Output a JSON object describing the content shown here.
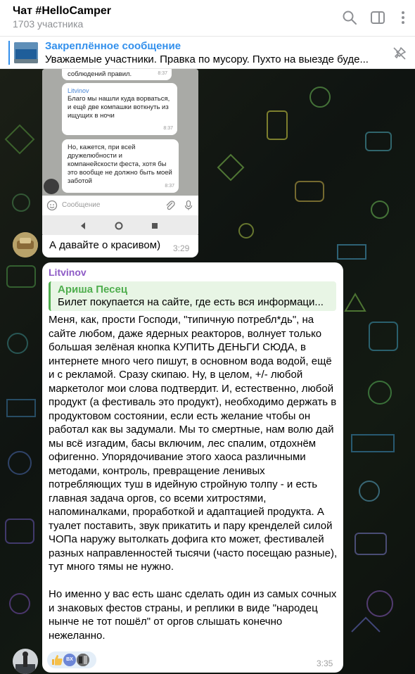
{
  "header": {
    "title": "Чат #HelloCamper",
    "members": "1703 участника",
    "icons": [
      "search-icon",
      "sidebar-toggle-icon",
      "more-icon"
    ]
  },
  "pinned": {
    "title": "Закреплённое сообщение",
    "text": "Уважаемые участники. Правка по мусору. Пухто на выезде буде...",
    "icon": "unpin-icon"
  },
  "screenshot_message": {
    "phone_top_text": "соблюдений правил.",
    "phone_top_time": "8:37",
    "phone_msg1_name": "Litvinov",
    "phone_msg1_text": "Благо мы нашли куда ворваться, и ещё две компашки воткнуть из ищущих в ночи",
    "phone_msg1_time": "8:37",
    "phone_msg2_text": "Но, кажется, при всей дружелюбности и компанейскости феста, хотя бы это вообще не должно быть моей заботой",
    "phone_msg2_time": "8:37",
    "phone_input_placeholder": "Сообщение",
    "caption": "А давайте о красивом)",
    "time": "3:29"
  },
  "message": {
    "sender": "Litvinov",
    "reply_name": "Ариша Песец",
    "reply_text": "Билет покупается на сайте, где есть вся информаци...",
    "body": "Меня, как, прости Господи, \"типичную потребл*дь\", на сайте любом, даже ядерных реакторов, волнует только большая зелёная кнопка КУПИТЬ ДЕНЬГИ СЮДА, в интернете много чего пишут, в основном вода водой, ещё и с рекламой. Сразу скипаю. Ну, в целом, +/- любой маркетолог мои слова подтвердит. И, естественно, любой продукт (а фестиваль это продукт), необходимо держать в продуктовом состоянии, если есть желание чтобы он работал как вы задумали. Мы то смертные, нам волю дай мы всё изгадим, басы включим, лес спалим, отдохнём офигенно. Упорядочивание этого хаоса различными методами, контроль, превращение ленивых потребляющих туш в идейную стройную толпу - и есть главная задача оргов, со всеми хитростями, напоминалками, проработкой и адаптацией продукта. А туалет поставить, звук прикатить и пару кренделей силой ЧОПа наружу вытолкать дофига кто может, фестивалей разных направленностей тысячи (часто посещаю разные), тут много тямы не нужно.\n\nНо именно у вас есть шанс сделать один из самых сочных и знаковых фестов страны, и реплики в виде \"народец нынче не тот пошёл\" от оргов слышать конечно нежеланно.",
    "reaction_badge": "BX",
    "reactions": [
      "thumbs-up-icon",
      "user-avatar",
      "user-avatar"
    ],
    "time": "3:35"
  },
  "colors": {
    "accent": "#3390ec",
    "sender": "#8e5bc6",
    "reply_accent": "#4fae4e"
  }
}
